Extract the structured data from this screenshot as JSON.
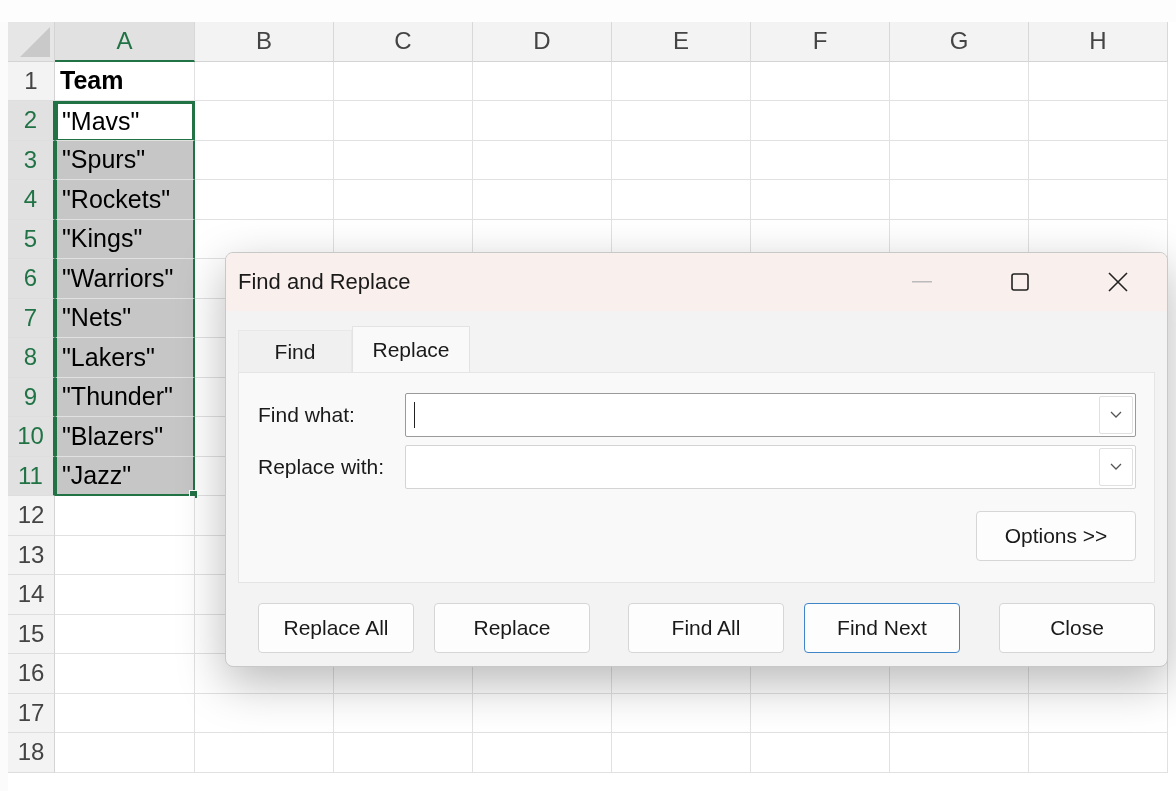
{
  "sheet": {
    "columns": [
      {
        "label": "A",
        "selected": true
      },
      {
        "label": "B",
        "selected": false
      },
      {
        "label": "C",
        "selected": false
      },
      {
        "label": "D",
        "selected": false
      },
      {
        "label": "E",
        "selected": false
      },
      {
        "label": "F",
        "selected": false
      },
      {
        "label": "G",
        "selected": false
      },
      {
        "label": "H",
        "selected": false
      }
    ],
    "rows": [
      {
        "number": "1",
        "kind": "header",
        "selected": false,
        "active": false,
        "value": "Team"
      },
      {
        "number": "2",
        "kind": "data",
        "selected": true,
        "active": true,
        "value": "\"Mavs\""
      },
      {
        "number": "3",
        "kind": "data",
        "selected": true,
        "active": false,
        "value": "\"Spurs\""
      },
      {
        "number": "4",
        "kind": "data",
        "selected": true,
        "active": false,
        "value": "\"Rockets\""
      },
      {
        "number": "5",
        "kind": "data",
        "selected": true,
        "active": false,
        "value": "\"Kings\""
      },
      {
        "number": "6",
        "kind": "data",
        "selected": true,
        "active": false,
        "value": "\"Warriors\""
      },
      {
        "number": "7",
        "kind": "data",
        "selected": true,
        "active": false,
        "value": "\"Nets\""
      },
      {
        "number": "8",
        "kind": "data",
        "selected": true,
        "active": false,
        "value": "\"Lakers\""
      },
      {
        "number": "9",
        "kind": "data",
        "selected": true,
        "active": false,
        "value": "\"Thunder\""
      },
      {
        "number": "10",
        "kind": "data",
        "selected": true,
        "active": false,
        "value": "\"Blazers\""
      },
      {
        "number": "11",
        "kind": "data",
        "selected": true,
        "active": false,
        "value": "\"Jazz\""
      },
      {
        "number": "12",
        "kind": "empty",
        "selected": false,
        "active": false
      },
      {
        "number": "13",
        "kind": "empty",
        "selected": false,
        "active": false
      },
      {
        "number": "14",
        "kind": "empty",
        "selected": false,
        "active": false
      },
      {
        "number": "15",
        "kind": "empty",
        "selected": false,
        "active": false
      },
      {
        "number": "16",
        "kind": "empty",
        "selected": false,
        "active": false
      },
      {
        "number": "17",
        "kind": "empty",
        "selected": false,
        "active": false
      },
      {
        "number": "18",
        "kind": "empty",
        "selected": false,
        "active": false
      }
    ]
  },
  "dialog": {
    "title": "Find and Replace",
    "tabs": [
      {
        "label": "Find",
        "selected": false
      },
      {
        "label": "Replace",
        "selected": true
      }
    ],
    "fields": [
      {
        "label": "Find what:",
        "focused": true
      },
      {
        "label": "Replace with:",
        "focused": false
      }
    ],
    "options_button": {
      "label": "Options >>"
    },
    "buttons": [
      {
        "label": "Replace All",
        "default": false
      },
      {
        "label": "Replace",
        "default": false
      },
      {
        "label": "Find All",
        "default": false
      },
      {
        "label": "Find Next",
        "default": true
      },
      {
        "label": "Close",
        "default": false
      }
    ]
  }
}
